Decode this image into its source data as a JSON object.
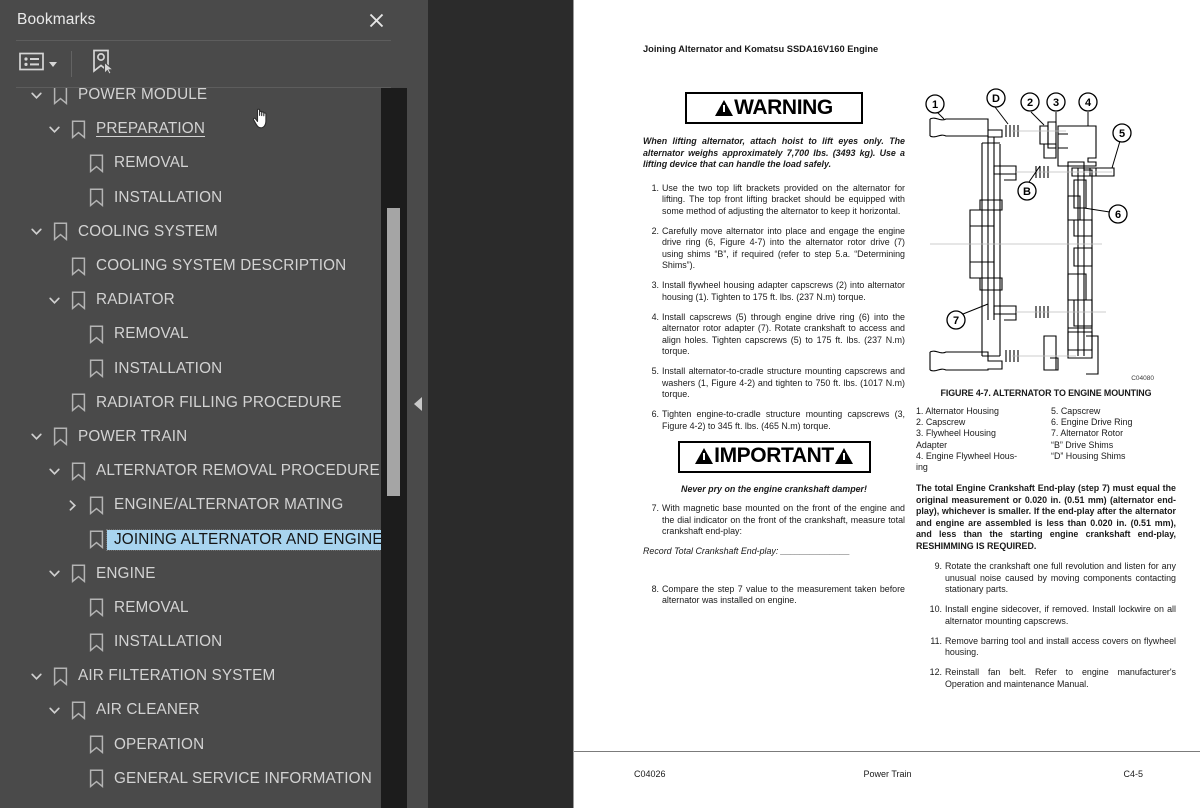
{
  "panel": {
    "title": "Bookmarks",
    "close_icon": "close-icon",
    "toolbar": {
      "options_icon": "list-options-icon",
      "options_caret": "chevron-down-icon",
      "new_bookmark_icon": "new-bookmark-icon"
    },
    "collapse_icon": "collapse-left-icon",
    "tree": [
      {
        "label": "POWER MODULE",
        "level": 0,
        "twisty": "expanded",
        "state": "normal"
      },
      {
        "label": "PREPARATION",
        "level": 1,
        "twisty": "expanded",
        "state": "underlined"
      },
      {
        "label": "REMOVAL",
        "level": 2,
        "twisty": "none",
        "state": "normal"
      },
      {
        "label": "INSTALLATION",
        "level": 2,
        "twisty": "none",
        "state": "normal"
      },
      {
        "label": "COOLING SYSTEM",
        "level": 0,
        "twisty": "expanded",
        "state": "normal"
      },
      {
        "label": "COOLING SYSTEM DESCRIPTION",
        "level": 1,
        "twisty": "none",
        "state": "normal"
      },
      {
        "label": "RADIATOR",
        "level": 1,
        "twisty": "expanded",
        "state": "normal"
      },
      {
        "label": "REMOVAL",
        "level": 2,
        "twisty": "none",
        "state": "normal"
      },
      {
        "label": "INSTALLATION",
        "level": 2,
        "twisty": "none",
        "state": "normal"
      },
      {
        "label": "RADIATOR FILLING PROCEDURE",
        "level": 1,
        "twisty": "none",
        "state": "normal"
      },
      {
        "label": "POWER TRAIN",
        "level": 0,
        "twisty": "expanded",
        "state": "normal"
      },
      {
        "label": "ALTERNATOR REMOVAL PROCEDURE",
        "level": 1,
        "twisty": "expanded",
        "state": "normal"
      },
      {
        "label": "ENGINE/ALTERNATOR MATING",
        "level": 2,
        "twisty": "collapsed",
        "state": "normal"
      },
      {
        "label": "JOINING ALTERNATOR AND ENGINE",
        "level": 2,
        "twisty": "none",
        "state": "selected"
      },
      {
        "label": "ENGINE",
        "level": 1,
        "twisty": "expanded",
        "state": "normal"
      },
      {
        "label": "REMOVAL",
        "level": 2,
        "twisty": "none",
        "state": "normal"
      },
      {
        "label": "INSTALLATION",
        "level": 2,
        "twisty": "none",
        "state": "normal"
      },
      {
        "label": "AIR FILTERATION SYSTEM",
        "level": 0,
        "twisty": "expanded",
        "state": "normal"
      },
      {
        "label": "AIR CLEANER",
        "level": 1,
        "twisty": "expanded",
        "state": "normal"
      },
      {
        "label": "OPERATION",
        "level": 2,
        "twisty": "none",
        "state": "normal"
      },
      {
        "label": "GENERAL SERVICE INFORMATION",
        "level": 2,
        "twisty": "none",
        "state": "normal"
      }
    ]
  },
  "document": {
    "heading": "Joining Alternator and Komatsu SSDA16V160 Engine",
    "warning": {
      "label": "WARNING",
      "text": "When lifting alternator, attach hoist to lift eyes only. The alternator weighs approximately 7,700 lbs. (3493 kg). Use a lifting device that can handle the load safely."
    },
    "steps_left": [
      {
        "num": "1.",
        "text": "Use the two top lift brackets provided on the alternator for lifting. The top front lifting bracket should be equipped with some method of adjusting the alternator to keep it horizontal."
      },
      {
        "num": "2.",
        "text": "Carefully move alternator into place and engage the engine drive ring (6, Figure 4-7) into the alternator rotor drive (7) using shims “B”, if required (refer to step 5.a. “Determining Shims”)."
      },
      {
        "num": "3.",
        "text": "Install flywheel housing adapter capscrews (2) into alternator housing (1). Tighten to 175 ft. lbs. (237 N.m) torque."
      },
      {
        "num": "4.",
        "text": "Install capscrews (5) through engine drive ring (6) into the alternator rotor adapter (7). Rotate crankshaft to access and align holes. Tighten capscrews (5) to 175 ft. lbs. (237 N.m) torque."
      },
      {
        "num": "5.",
        "text": "Install alternator-to-cradle structure mounting capscrews and washers (1, Figure 4-2) and tighten to 750 ft. lbs. (1017 N.m) torque."
      },
      {
        "num": "6.",
        "text": "Tighten engine-to-cradle structure mounting capscrews (3, Figure 4-2) to 345 ft. lbs. (465 N.m) torque."
      }
    ],
    "important": {
      "label": "IMPORTANT",
      "subtext": "Never pry on the engine crankshaft damper!"
    },
    "steps_left_after": [
      {
        "num": "7.",
        "text": "With magnetic base mounted on the front of the engine and the dial indicator on the front of the crankshaft, measure total crankshaft end-play:"
      }
    ],
    "record_line": "Record Total Crankshaft End-play: ______________",
    "steps_left_last": [
      {
        "num": "8.",
        "text": "Compare the step 7 value to the measurement taken before alternator was installed on engine."
      }
    ],
    "figure": {
      "caption": "FIGURE 4-7. ALTERNATOR TO ENGINE MOUNTING",
      "drawing_code": "C04080",
      "callouts": [
        "1",
        "D",
        "2",
        "3",
        "4",
        "5",
        "B",
        "6",
        "7"
      ],
      "legend_left": [
        "1. Alternator Housing",
        "2. Capscrew",
        "3. Flywheel Housing\n    Adapter",
        "4. Engine Flywheel Hous-\n    ing"
      ],
      "legend_right": [
        "5. Capscrew",
        "6. Engine Drive Ring",
        "7. Alternator Rotor",
        "“B” Drive Shims",
        "“D” Housing Shims"
      ]
    },
    "paragraph_endplay": "The total Engine Crankshaft End-play (step 7) must equal the original measurement or 0.020 in. (0.51 mm) (alternator end-play), whichever is smaller. If the end-play after the alternator and engine are assembled is less than 0.020 in. (0.51 mm), and less than the starting engine crankshaft end-play, RESHIMMING IS REQUIRED.",
    "steps_right": [
      {
        "num": "9.",
        "text": "Rotate the crankshaft one full revolution and listen for any unusual noise caused by moving components contacting stationary parts."
      },
      {
        "num": "10.",
        "text": "Install engine sidecover, if removed. Install lockwire on all alternator mounting capscrews."
      },
      {
        "num": "11.",
        "text": "Remove barring tool and install access covers on flywheel housing."
      },
      {
        "num": "12.",
        "text": "Reinstall fan belt. Refer to engine manufacturer's Operation and maintenance Manual."
      }
    ],
    "footer": {
      "left": "C04026",
      "center": "Power Train",
      "right": "C4-5"
    }
  },
  "colors": {
    "panel_bg": "#4a4a4a",
    "viewer_bg": "#2b2b2b",
    "page_bg": "#ffffff",
    "selection": "#a8d4ef",
    "scrollbar_track": "#1c1c1c",
    "scrollbar_thumb": "#a5a5a5",
    "text": "#d3d3d3"
  }
}
